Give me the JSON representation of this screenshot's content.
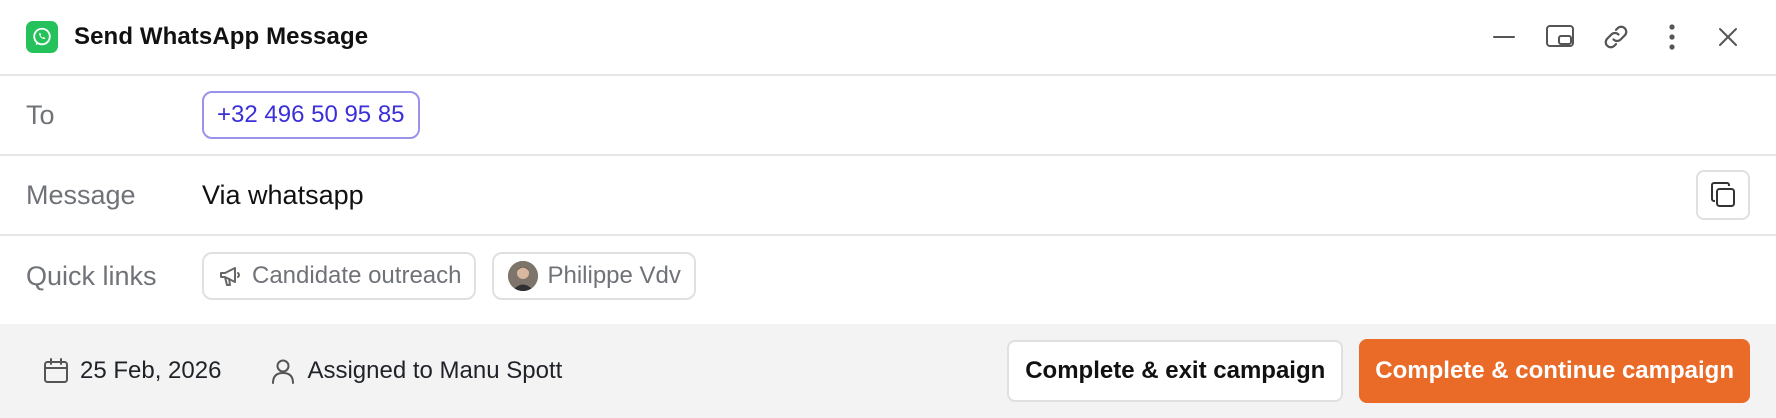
{
  "header": {
    "title": "Send WhatsApp Message",
    "icons": [
      "whatsapp-icon",
      "minimize-icon",
      "picture-in-picture-icon",
      "link-icon",
      "more-vertical-icon",
      "close-icon"
    ],
    "brand_color": "#25c15a"
  },
  "to": {
    "label": "To",
    "phone": "+32 496 50 95 85",
    "chip_color": "#3b2fd9"
  },
  "message": {
    "label": "Message",
    "text": "Via whatsapp",
    "copy_icon": "copy-icon"
  },
  "quick_links": {
    "label": "Quick links",
    "items": [
      {
        "label": "Candidate outreach",
        "icon": "megaphone-icon"
      },
      {
        "label": "Philippe Vdv",
        "icon": "avatar"
      }
    ]
  },
  "footer": {
    "date": "25 Feb, 2026",
    "assigned": "Assigned to Manu Spott",
    "exit_button": "Complete & exit campaign",
    "continue_button": "Complete & continue campaign",
    "accent_color": "#ea6a28",
    "background": "#f3f3f3"
  }
}
